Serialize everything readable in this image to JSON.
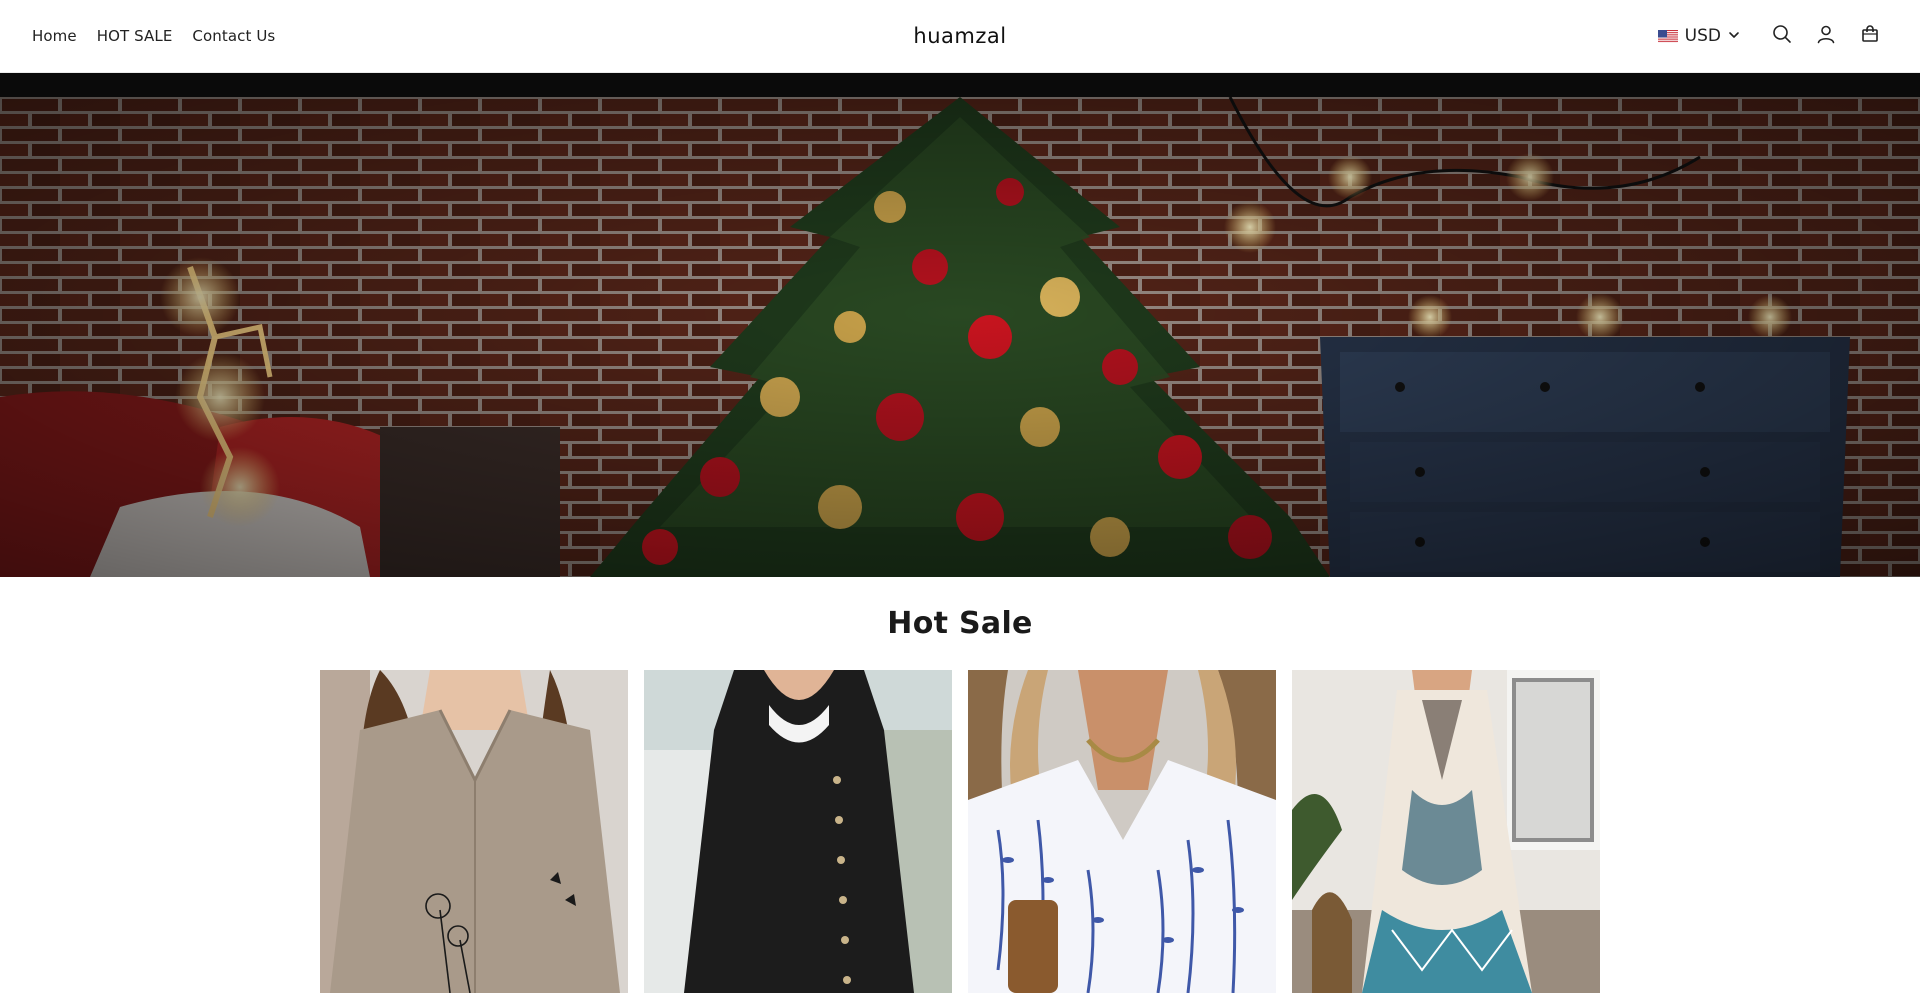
{
  "header": {
    "nav": [
      {
        "label": "Home"
      },
      {
        "label": "HOT SALE"
      },
      {
        "label": "Contact Us"
      }
    ],
    "brand": "huamzal",
    "currency": {
      "code": "USD",
      "flag_icon": "us-flag-icon"
    },
    "icons": [
      "search-icon",
      "account-icon",
      "cart-icon"
    ]
  },
  "hero": {
    "image_theme": "christmas-tree-brick-wall"
  },
  "hot_sale": {
    "title": "Hot Sale",
    "products": [
      {
        "image_theme": "beige-dandelion-top"
      },
      {
        "image_theme": "black-button-dress"
      },
      {
        "image_theme": "blue-floral-shirt"
      },
      {
        "image_theme": "boho-maxi-dress"
      }
    ]
  },
  "colors": {
    "header_bg": "#ffffff",
    "strip_bg": "#0a0a0a",
    "text": "#1f1f1f"
  }
}
